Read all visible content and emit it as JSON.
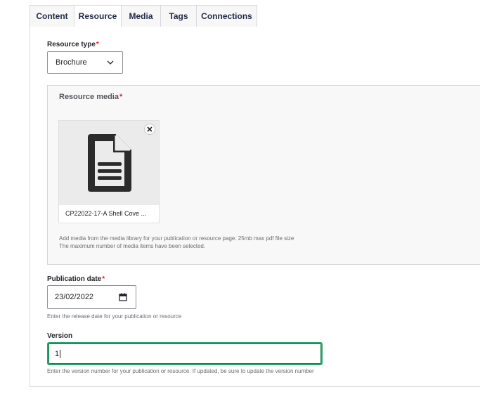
{
  "tabs": [
    {
      "label": "Content",
      "active": false
    },
    {
      "label": "Resource",
      "active": true
    },
    {
      "label": "Media",
      "active": false
    },
    {
      "label": "Tags",
      "active": false
    },
    {
      "label": "Connections",
      "active": false
    }
  ],
  "resource_type": {
    "label": "Resource type",
    "required_mark": "*",
    "selected": "Brochure",
    "icon": "chevron-down-icon"
  },
  "resource_media": {
    "label": "Resource media",
    "required_mark": "*",
    "item": {
      "filename": "CP22022-17-A Shell Cove ...",
      "icon": "document-icon",
      "remove_icon": "close-icon"
    },
    "help_line_1": "Add media from the media library for your publication or resource page. 25mb max pdf file size",
    "help_line_2": "The maximum number of media items have been selected."
  },
  "publication_date": {
    "label": "Publication date",
    "required_mark": "*",
    "value": "23/02/2022",
    "icon": "calendar-icon",
    "help": "Enter the release date for your publication or resource"
  },
  "version": {
    "label": "Version",
    "value": "1",
    "help": "Enter the version number for your publication or resource. If updated, be sure to update the version number"
  },
  "colors": {
    "focus": "#26a769",
    "required": "#d3252b",
    "tab_text": "#1f2a44"
  }
}
